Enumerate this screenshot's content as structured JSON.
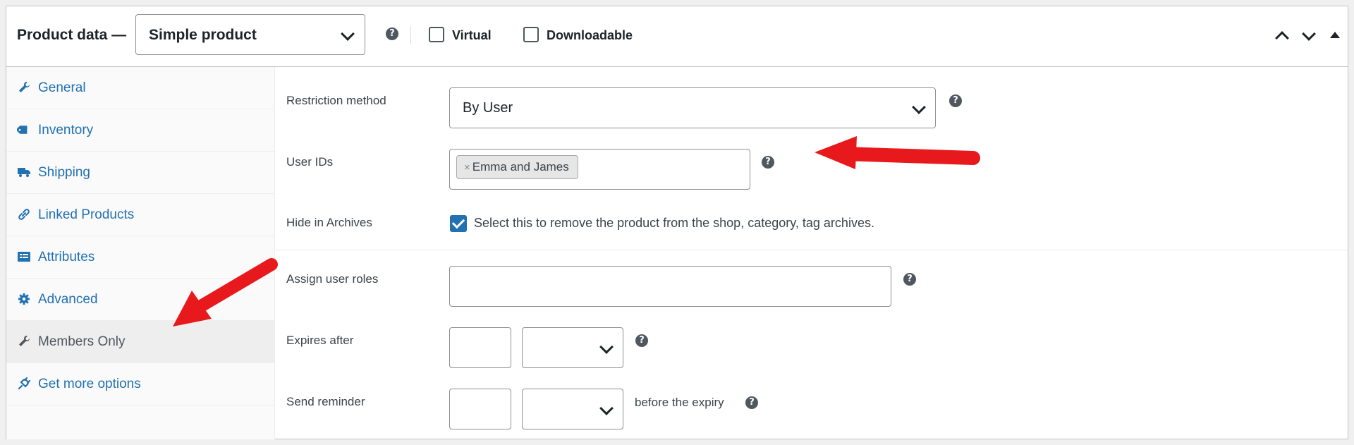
{
  "header": {
    "title": "Product data —",
    "product_type": "Simple product",
    "virtual_label": "Virtual",
    "downloadable_label": "Downloadable"
  },
  "tabs": [
    {
      "label": "General",
      "icon": "wrench-icon",
      "active": false
    },
    {
      "label": "Inventory",
      "icon": "tag-icon",
      "active": false
    },
    {
      "label": "Shipping",
      "icon": "truck-icon",
      "active": false
    },
    {
      "label": "Linked Products",
      "icon": "link-icon",
      "active": false
    },
    {
      "label": "Attributes",
      "icon": "list-icon",
      "active": false
    },
    {
      "label": "Advanced",
      "icon": "gear-icon",
      "active": false
    },
    {
      "label": "Members Only",
      "icon": "wrench-icon",
      "active": true
    },
    {
      "label": "Get more options",
      "icon": "plugin-icon",
      "active": false
    }
  ],
  "fields": {
    "restriction_method_label": "Restriction method",
    "restriction_method_value": "By User",
    "user_ids_label": "User IDs",
    "user_ids_token": "Emma and James",
    "hide_label": "Hide in Archives",
    "hide_desc": "Select this to remove the product from the shop, category, tag archives.",
    "assign_roles_label": "Assign user roles",
    "expires_label": "Expires after",
    "reminder_label": "Send reminder",
    "reminder_suffix": "before the expiry"
  },
  "colors": {
    "link": "#2271b1",
    "arrow": "#e8191c"
  }
}
